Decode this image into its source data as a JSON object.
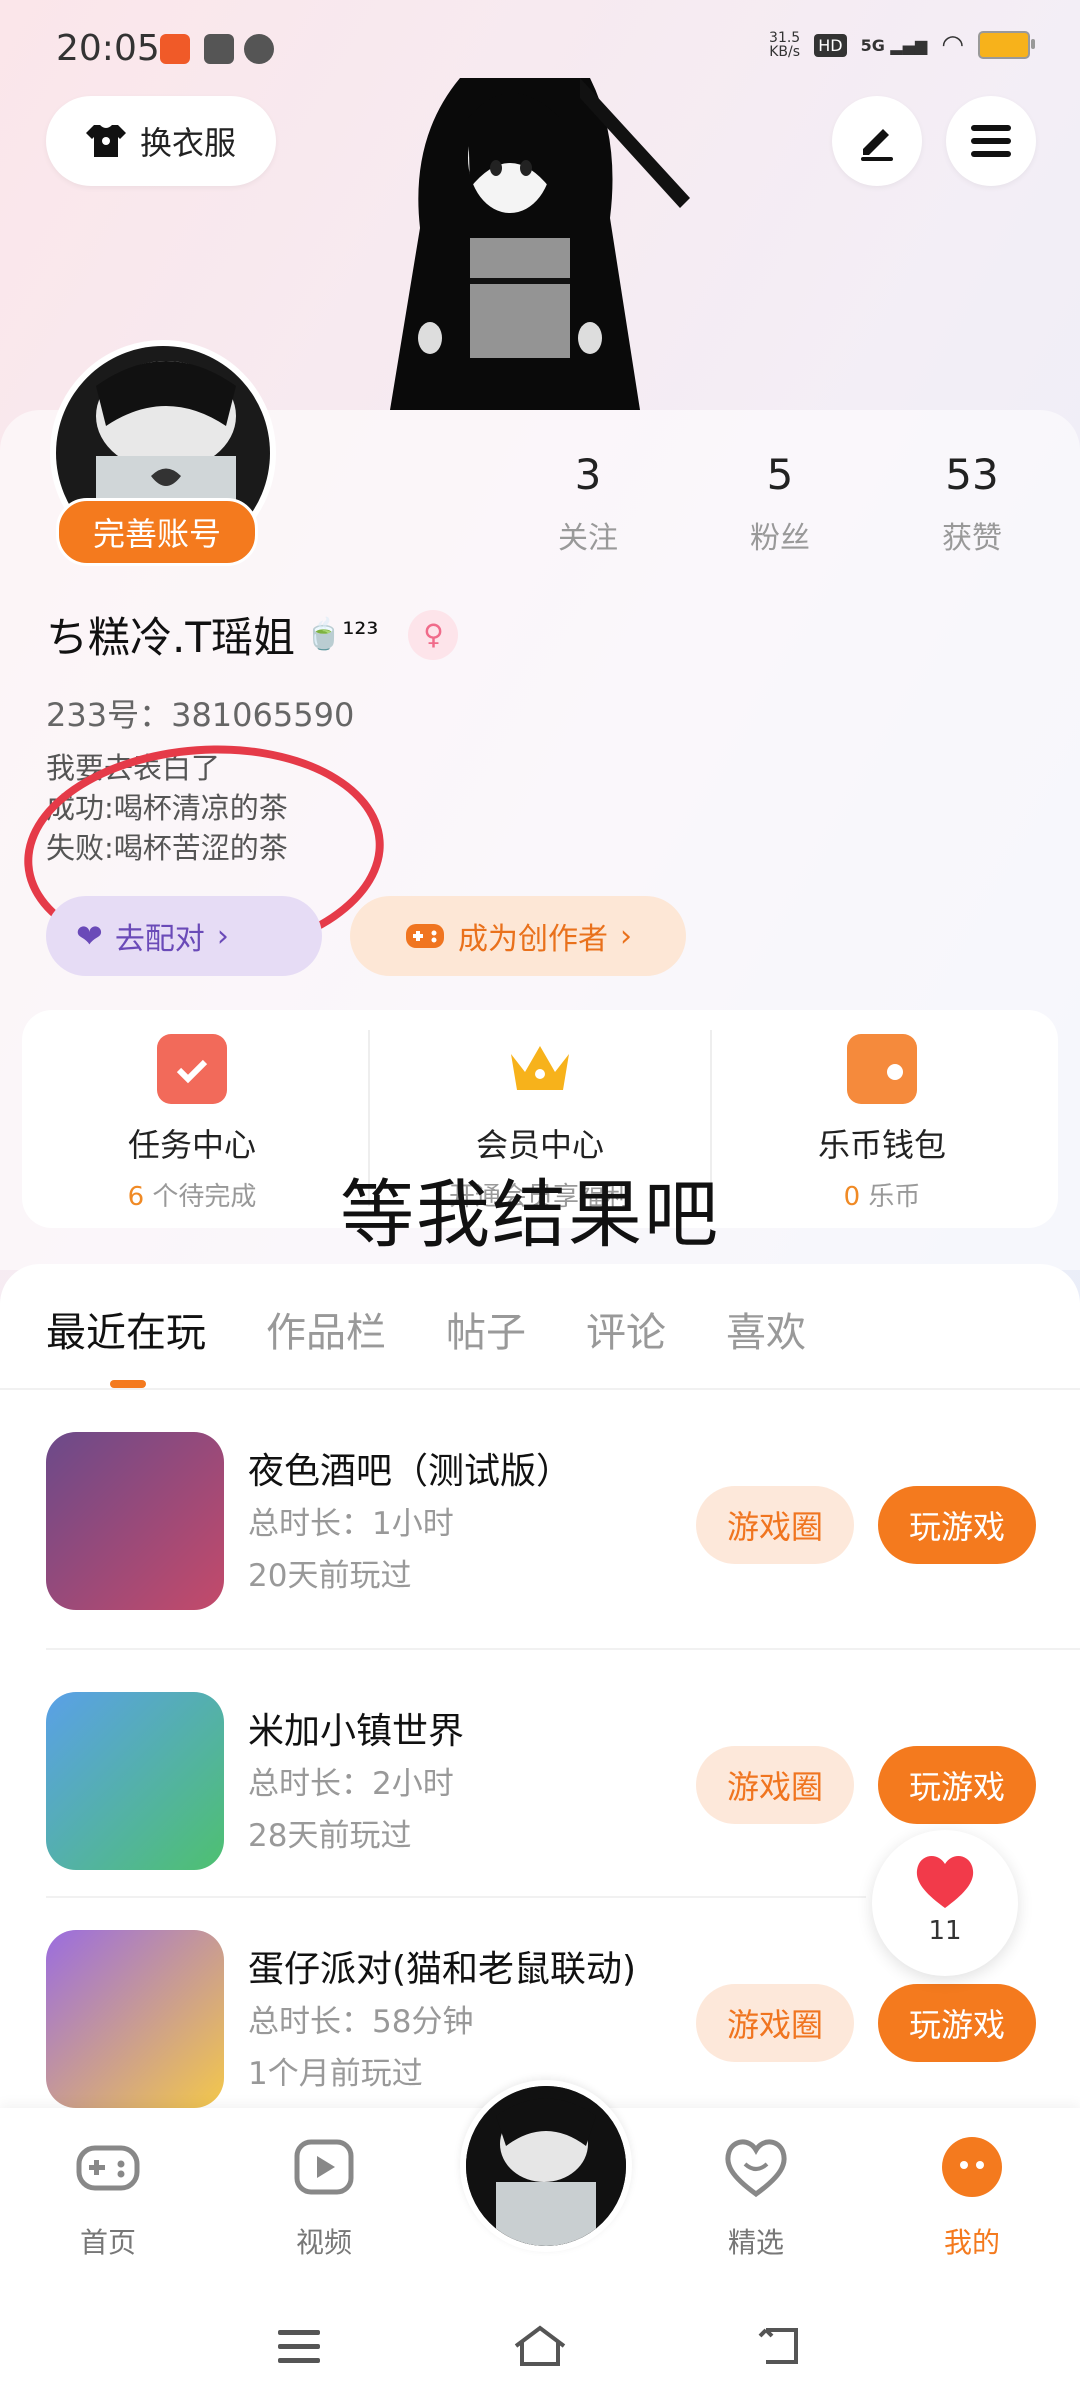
{
  "status_bar": {
    "time": "20:05",
    "net_speed": "31.5\nKB/s",
    "hd": "HD",
    "signal": "5G"
  },
  "top": {
    "dress_label": "换衣服"
  },
  "profile": {
    "complete_badge": "完善账号",
    "stats": [
      {
        "value": "3",
        "label": "关注"
      },
      {
        "value": "5",
        "label": "粉丝"
      },
      {
        "value": "53",
        "label": "获赞"
      }
    ],
    "nickname": "ち糕冷.T瑶姐",
    "nickname_suffix": "🍵¹²³",
    "id_text": "233号：381065590",
    "bio": "我要去表白了\n成功:喝杯清凉的茶\n失败:喝杯苦涩的茶",
    "match_label": "去配对",
    "creator_label": "成为创作者"
  },
  "services": [
    {
      "title": "任务中心",
      "sub_num": "6",
      "sub_text": " 个待完成"
    },
    {
      "title": "会员中心",
      "sub_num": "",
      "sub_text": "开通会员享福利"
    },
    {
      "title": "乐币钱包",
      "sub_num": "0",
      "sub_text": " 乐币"
    }
  ],
  "overlay_text": "等我结果吧",
  "tabs": [
    "最近在玩",
    "作品栏",
    "帖子",
    "评论",
    "喜欢"
  ],
  "games": [
    {
      "name": "夜色酒吧（测试版）",
      "duration": "总时长：1小时",
      "last": "20天前玩过",
      "circle": "游戏圈",
      "play": "玩游戏"
    },
    {
      "name": "米加小镇世界",
      "duration": "总时长：2小时",
      "last": "28天前玩过",
      "circle": "游戏圈",
      "play": "玩游戏"
    },
    {
      "name": "蛋仔派对(猫和老鼠联动)",
      "duration": "总时长：58分钟",
      "last": "1个月前玩过",
      "circle": "游戏圈",
      "play": "玩游戏"
    }
  ],
  "like_float": {
    "count": "11"
  },
  "bottom_nav": [
    {
      "label": "首页",
      "icon": "gamepad-icon"
    },
    {
      "label": "视频",
      "icon": "play-icon"
    },
    {
      "label": "精选",
      "icon": "heart-smile-icon"
    },
    {
      "label": "我的",
      "icon": "me-icon"
    }
  ],
  "colors": {
    "accent": "#f47a1e",
    "annotation": "#e53a48"
  }
}
